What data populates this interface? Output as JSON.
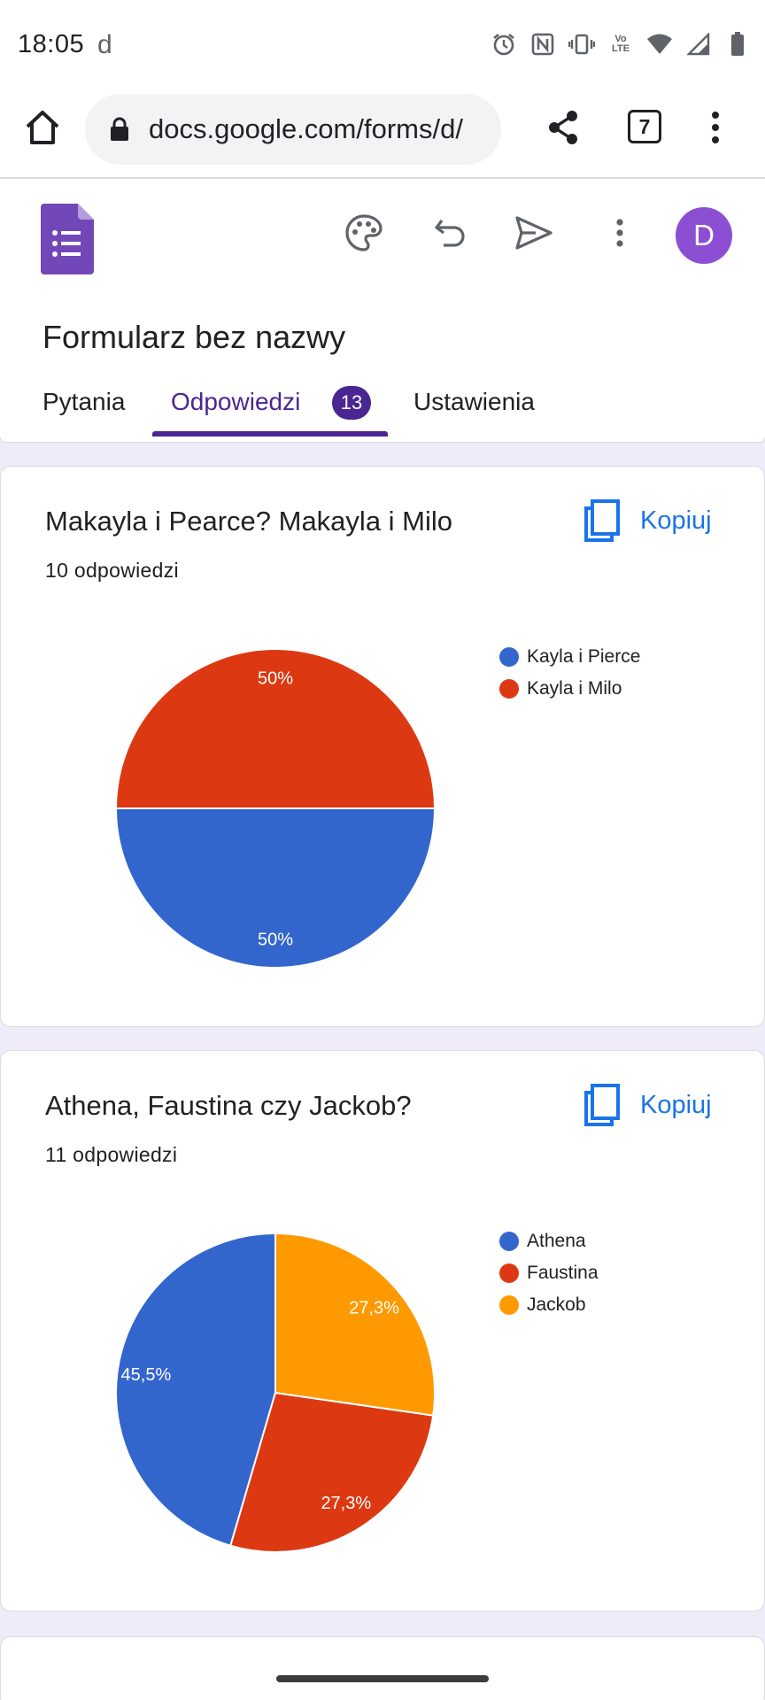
{
  "status_bar": {
    "time": "18:05",
    "app_icon": "d",
    "icons": [
      "alarm-icon",
      "nfc-icon",
      "vibrate-icon",
      "volte-icon",
      "wifi-icon",
      "signal-icon",
      "battery-icon"
    ],
    "volte_label_top": "Vo",
    "volte_label_bottom": "LTE"
  },
  "browser": {
    "url": "docs.google.com/forms/d/",
    "tab_count": "7"
  },
  "forms": {
    "title": "Formularz bez nazwy",
    "avatar_letter": "D",
    "tabs": [
      {
        "label": "Pytania",
        "active": false
      },
      {
        "label": "Odpowiedzi",
        "active": true,
        "badge": "13"
      },
      {
        "label": "Ustawienia",
        "active": false
      }
    ]
  },
  "cards": [
    {
      "title": "Makayla i Pearce? Makayla i Milo",
      "responses": "10 odpowiedzi",
      "copy_label": "Kopiuj"
    },
    {
      "title": "Athena, Faustina czy Jackob?",
      "responses": "11 odpowiedzi",
      "copy_label": "Kopiuj"
    }
  ],
  "colors": {
    "accent": "#4a2692",
    "link": "#1a73e8",
    "blue": "#3366cc",
    "red": "#dc3912",
    "orange": "#ff9900"
  },
  "chart_data": [
    {
      "type": "pie",
      "slices": [
        {
          "label": "Kayla i Pierce",
          "value": 50,
          "display": "50%",
          "color": "#3366cc"
        },
        {
          "label": "Kayla i Milo",
          "value": 50,
          "display": "50%",
          "color": "#dc3912"
        }
      ],
      "legend": "right"
    },
    {
      "type": "pie",
      "slices": [
        {
          "label": "Athena",
          "value": 45.5,
          "display": "45,5%",
          "color": "#3366cc"
        },
        {
          "label": "Faustina",
          "value": 27.3,
          "display": "27,3%",
          "color": "#dc3912"
        },
        {
          "label": "Jackob",
          "value": 27.3,
          "display": "27,3%",
          "color": "#ff9900"
        }
      ],
      "legend": "right"
    }
  ]
}
